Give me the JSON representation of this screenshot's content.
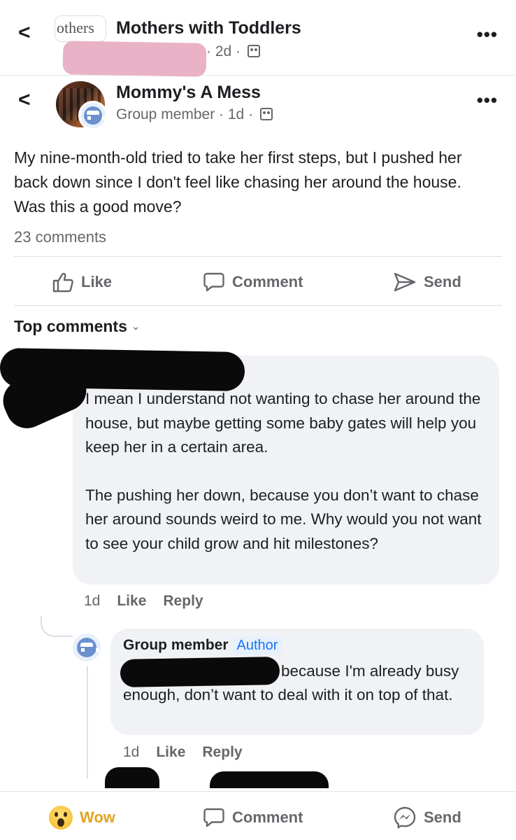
{
  "header": {
    "back_glyph": "<",
    "group_thumb_text": "others",
    "group_name": "Mothers with Toddlers",
    "group_meta": "· 2d ·",
    "more_glyph": "•••"
  },
  "post": {
    "back_glyph": "<",
    "author": "Mommy's A Mess",
    "meta": "Group member · 1d ·",
    "more_glyph": "•••",
    "text": "My nine-month-old tried to take her first steps, but I pushed her back down since I don't feel like chasing her around the house. Was this a good move?",
    "comment_count": "23 comments"
  },
  "actions": {
    "like": "Like",
    "comment": "Comment",
    "send": "Send"
  },
  "comments_header": {
    "label": "Top comments",
    "caret": "⌄"
  },
  "comments": [
    {
      "paragraph1": "I mean I understand not wanting to chase her around the house, but maybe getting some baby gates will help you keep her in a certain area.",
      "paragraph2": "The pushing her down, because you don’t want to chase her around sounds weird to me. Why would you not want to see your child grow and hit milestones?",
      "time": "1d",
      "like": "Like",
      "reply": "Reply"
    }
  ],
  "reply": {
    "name": "Group member",
    "badge": "Author",
    "text": "because I'm already busy enough, don’t want to deal with it on top of that.",
    "time": "1d",
    "like": "Like",
    "reply": "Reply"
  },
  "bottom_bar": {
    "reaction": "Wow",
    "comment": "Comment",
    "send": "Send"
  },
  "colors": {
    "accent": "#1877f2",
    "muted_text": "#65676b",
    "bubble": "#f0f2f5",
    "wow": "#e1a424",
    "redaction_pink": "#e9b2c6"
  },
  "icons": [
    "back-chevron-icon",
    "group-members-icon",
    "like-thumb-icon",
    "comment-bubble-icon",
    "send-arrow-icon",
    "anonymous-member-icon",
    "wow-reaction-icon",
    "messenger-icon"
  ]
}
